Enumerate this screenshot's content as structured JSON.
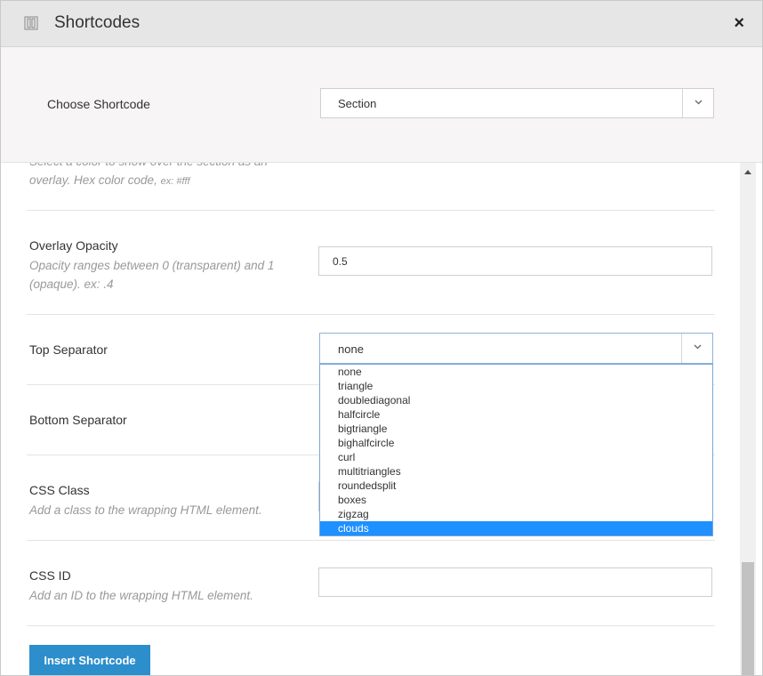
{
  "header": {
    "title": "Shortcodes",
    "close": "×"
  },
  "chooser": {
    "label": "Choose Shortcode",
    "selected": "Section"
  },
  "overlay_color": {
    "desc": "Select a color to show over the section as an overlay. Hex color code,",
    "example": "ex: #fff"
  },
  "overlay_opacity": {
    "label": "Overlay Opacity",
    "desc": "Opacity ranges between 0 (transparent) and 1 (opaque). ex: .4",
    "value": "0.5"
  },
  "top_separator": {
    "label": "Top Separator",
    "selected": "none",
    "options": [
      "none",
      "triangle",
      "doublediagonal",
      "halfcircle",
      "bigtriangle",
      "bighalfcircle",
      "curl",
      "multitriangles",
      "roundedsplit",
      "boxes",
      "zigzag",
      "clouds"
    ],
    "highlighted": "clouds"
  },
  "bottom_separator": {
    "label": "Bottom Separator"
  },
  "css_class": {
    "label": "CSS Class",
    "desc": "Add a class to the wrapping HTML element."
  },
  "css_id": {
    "label": "CSS ID",
    "desc": "Add an ID to the wrapping HTML element.",
    "value": ""
  },
  "footer": {
    "insert_label": "Insert Shortcode"
  },
  "colors": {
    "accent": "#2c8ecb",
    "highlight": "#1e90ff"
  }
}
